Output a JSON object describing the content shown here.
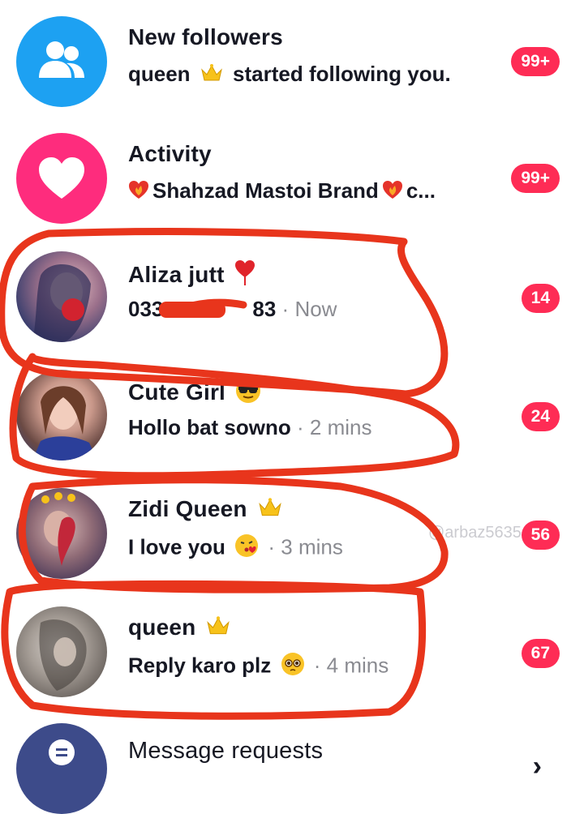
{
  "rows": [
    {
      "name": "New followers",
      "preview": "queen",
      "preview_suffix": "started following you.",
      "badge": "99+",
      "avatar": "people-icon",
      "avatar_color": "#1da1f2"
    },
    {
      "name": "Activity",
      "preview": "Shahzad Mastoi Brand",
      "preview_suffix": "c...",
      "badge": "99+",
      "avatar": "heart-icon",
      "avatar_color": "#fe2c7d"
    },
    {
      "name": "Aliza jutt",
      "preview": "033",
      "preview_suffix": "83",
      "time": "Now",
      "badge": "14"
    },
    {
      "name": "Cute Girl",
      "preview": "Hollo bat sowno",
      "time": "2 mins",
      "badge": "24"
    },
    {
      "name": "Zidi Queen",
      "preview": "I love you",
      "time": "3 mins",
      "badge": "56"
    },
    {
      "name": "queen",
      "preview": "Reply karo plz",
      "time": "4 mins",
      "badge": "67"
    }
  ],
  "message_requests": {
    "label": "Message requests",
    "icon": "chat-bubble-icon",
    "chevron": "›"
  },
  "watermark": "@arbaz5635",
  "colors": {
    "badge": "#fe2c55",
    "scribble": "#e8351c"
  }
}
